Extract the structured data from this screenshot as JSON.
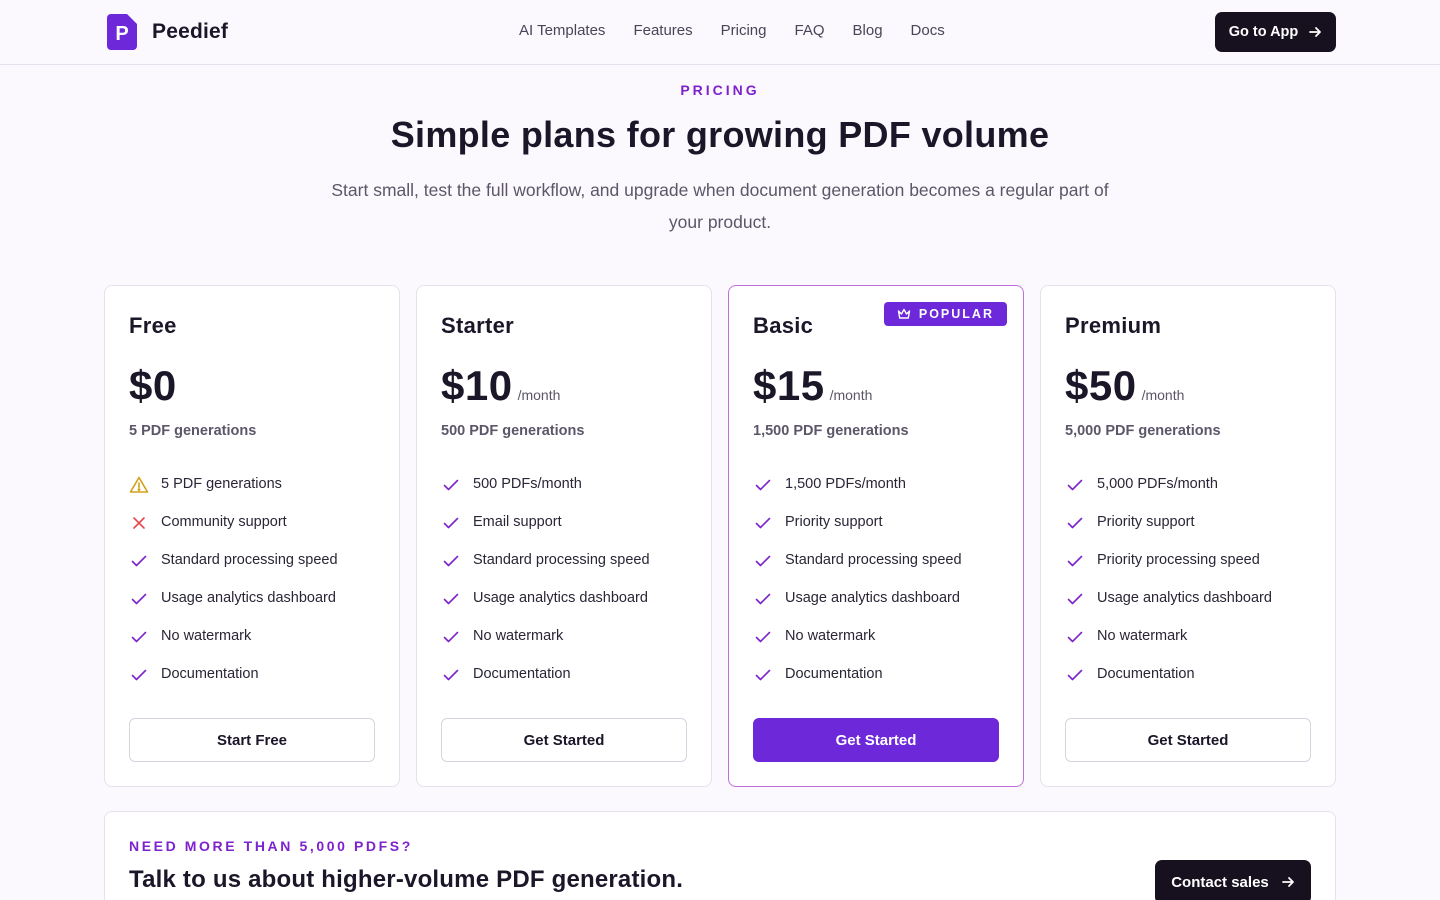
{
  "header": {
    "logo_letter": "P",
    "brand": "Peedief",
    "nav": [
      "AI Templates",
      "Features",
      "Pricing",
      "FAQ",
      "Blog",
      "Docs"
    ],
    "cta_label": "Go to App"
  },
  "hero": {
    "eyebrow": "PRICING",
    "title": "Simple plans for growing PDF volume",
    "subtitle": "Start small, test the full workflow, and upgrade when document generation becomes a regular part of your product."
  },
  "plans": [
    {
      "name": "Free",
      "price": "$0",
      "period": "",
      "generations": "5 PDF generations",
      "features": [
        {
          "icon": "warning-icon",
          "text": "5 PDF generations"
        },
        {
          "icon": "x-icon",
          "text": "Community support"
        },
        {
          "icon": "check-icon",
          "text": "Standard processing speed"
        },
        {
          "icon": "check-icon",
          "text": "Usage analytics dashboard"
        },
        {
          "icon": "check-icon",
          "text": "No watermark"
        },
        {
          "icon": "check-icon",
          "text": "Documentation"
        }
      ],
      "cta": "Start Free"
    },
    {
      "name": "Starter",
      "price": "$10",
      "period": "/month",
      "generations": "500 PDF generations",
      "features": [
        {
          "icon": "check-icon",
          "text": "500 PDFs/month"
        },
        {
          "icon": "check-icon",
          "text": "Email support"
        },
        {
          "icon": "check-icon",
          "text": "Standard processing speed"
        },
        {
          "icon": "check-icon",
          "text": "Usage analytics dashboard"
        },
        {
          "icon": "check-icon",
          "text": "No watermark"
        },
        {
          "icon": "check-icon",
          "text": "Documentation"
        }
      ],
      "cta": "Get Started"
    },
    {
      "name": "Basic",
      "price": "$15",
      "period": "/month",
      "generations": "1,500 PDF generations",
      "badge": "POPULAR",
      "features": [
        {
          "icon": "check-icon",
          "text": "1,500 PDFs/month"
        },
        {
          "icon": "check-icon",
          "text": "Priority support"
        },
        {
          "icon": "check-icon",
          "text": "Standard processing speed"
        },
        {
          "icon": "check-icon",
          "text": "Usage analytics dashboard"
        },
        {
          "icon": "check-icon",
          "text": "No watermark"
        },
        {
          "icon": "check-icon",
          "text": "Documentation"
        }
      ],
      "cta": "Get Started"
    },
    {
      "name": "Premium",
      "price": "$50",
      "period": "/month",
      "generations": "5,000 PDF generations",
      "features": [
        {
          "icon": "check-icon",
          "text": "5,000 PDFs/month"
        },
        {
          "icon": "check-icon",
          "text": "Priority support"
        },
        {
          "icon": "check-icon",
          "text": "Priority processing speed"
        },
        {
          "icon": "check-icon",
          "text": "Usage analytics dashboard"
        },
        {
          "icon": "check-icon",
          "text": "No watermark"
        },
        {
          "icon": "check-icon",
          "text": "Documentation"
        }
      ],
      "cta": "Get Started"
    }
  ],
  "banner": {
    "eyebrow": "NEED MORE THAN 5,000 PDFS?",
    "title": "Talk to us about higher-volume PDF generation.",
    "cta": "Contact sales"
  },
  "colors": {
    "accent": "#6d28d9",
    "accent_text": "#7e22ce",
    "dark": "#17111f",
    "warning": "#d4a017",
    "danger": "#e5484d"
  }
}
